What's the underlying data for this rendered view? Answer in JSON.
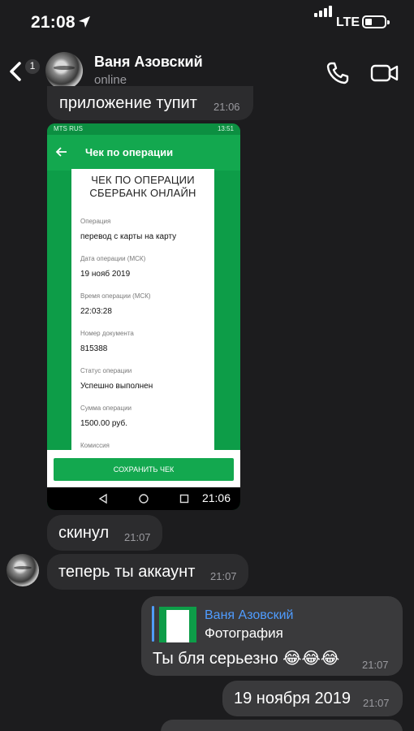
{
  "status_bar": {
    "time": "21:08",
    "network": "LTE"
  },
  "header": {
    "back_badge": "1",
    "contact_name": "Ваня Азовский",
    "contact_status": "online"
  },
  "messages": [
    {
      "text": "приложение тупит",
      "time": "21:06"
    },
    {
      "text": "скинул",
      "time": "21:07"
    },
    {
      "text": "теперь ты аккаунт",
      "time": "21:07"
    },
    {
      "text": "Ты бля серьезно 😂😂😂",
      "time": "21:07",
      "reply": {
        "name": "Ваня Азовский",
        "label": "Фотография"
      }
    },
    {
      "text": "19 ноября 2019",
      "time": "21:07"
    }
  ],
  "photo": {
    "status_left": "MTS RUS",
    "status_right": "13:51",
    "title": "Чек по операции",
    "heading_line1": "ЧЕК ПО ОПЕРАЦИИ",
    "heading_line2": "СБЕРБАНК ОНЛАЙН",
    "fields": [
      {
        "label": "Операция",
        "value": "перевод с карты на карту"
      },
      {
        "label": "Дата операции (МСК)",
        "value": "19 нояб 2019"
      },
      {
        "label": "Время операции (МСК)",
        "value": "22:03:28"
      },
      {
        "label": "Номер документа",
        "value": "815388"
      },
      {
        "label": "Статус операции",
        "value": "Успешно выполнен"
      },
      {
        "label": "Сумма операции",
        "value": "1500.00 руб."
      },
      {
        "label": "Комиссия",
        "value": ""
      }
    ],
    "save_button": "СОХРАНИТЬ ЧЕК",
    "time": "21:06"
  },
  "colors": {
    "accent": "#4f9cff",
    "sber_green": "#13a84f",
    "bubble": "#2c2c2e"
  }
}
